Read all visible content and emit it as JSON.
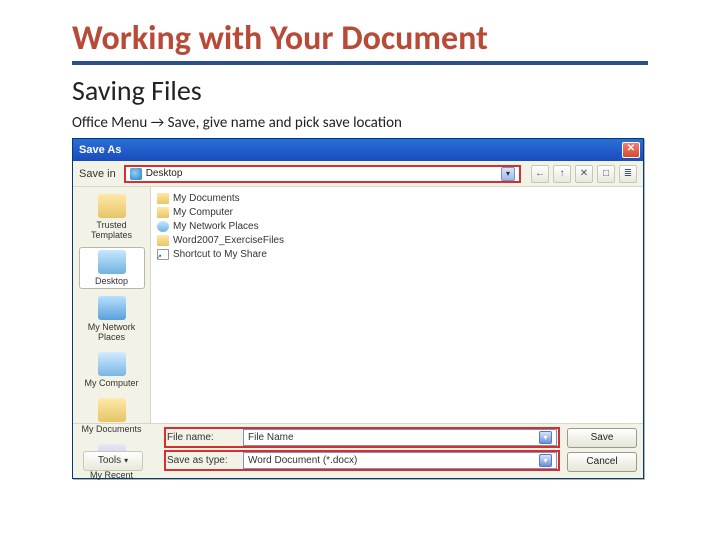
{
  "slide": {
    "title": "Working with Your Document",
    "subtitle": "Saving Files",
    "note": "Office Menu → Save, give name and pick save location"
  },
  "dialog": {
    "title": "Save As",
    "close_glyph": "✕",
    "savein_label": "Save in",
    "savein_value": "Desktop",
    "toolbar": {
      "back": "←",
      "up": "↑",
      "delete": "✕",
      "newfolder": "□",
      "views": "≣"
    },
    "places": [
      {
        "label": "Trusted Templates",
        "iconClass": "pi-trusted",
        "selected": false
      },
      {
        "label": "Desktop",
        "iconClass": "pi-desktop",
        "selected": true
      },
      {
        "label": "My Network Places",
        "iconClass": "pi-network",
        "selected": false
      },
      {
        "label": "My Computer",
        "iconClass": "pi-computer",
        "selected": false
      },
      {
        "label": "My Documents",
        "iconClass": "pi-docs",
        "selected": false
      },
      {
        "label": "My Recent",
        "iconClass": "pi-recent",
        "selected": false
      }
    ],
    "files": [
      {
        "name": "My Documents",
        "kind": "folder"
      },
      {
        "name": "My Computer",
        "kind": "folder"
      },
      {
        "name": "My Network Places",
        "kind": "net"
      },
      {
        "name": "Word2007_ExerciseFiles",
        "kind": "folder"
      },
      {
        "name": "Shortcut to My Share",
        "kind": "short"
      }
    ],
    "filename_label": "File name:",
    "filename_value": "File Name",
    "savetype_label": "Save as type:",
    "savetype_value": "Word Document (*.docx)",
    "tools_label": "Tools",
    "save_label": "Save",
    "cancel_label": "Cancel"
  }
}
